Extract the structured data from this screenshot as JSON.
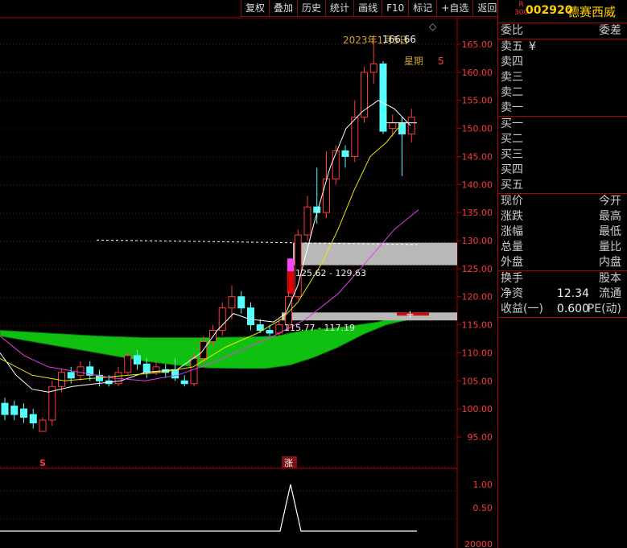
{
  "toolbar": {
    "buttons": [
      "复权",
      "叠加",
      "历史",
      "统计",
      "画线",
      "F10",
      "标记",
      "+自选",
      "返回"
    ]
  },
  "stock": {
    "badge_top": "R",
    "badge_bottom": "300",
    "code": "002920",
    "name": "德赛西威"
  },
  "panel": {
    "ratio_row": {
      "left": "委比",
      "right": "委差"
    },
    "sell_rows": [
      "卖五",
      "卖四",
      "卖三",
      "卖二",
      "卖一"
    ],
    "sell5_extra": "¥",
    "buy_rows": [
      "买一",
      "买二",
      "买三",
      "买四",
      "买五"
    ],
    "quote_rows": [
      {
        "left": "现价",
        "right": "今开"
      },
      {
        "left": "涨跌",
        "right": "最高"
      },
      {
        "left": "涨幅",
        "right": "最低"
      },
      {
        "left": "总量",
        "right": "量比"
      },
      {
        "left": "外盘",
        "right": "内盘"
      }
    ],
    "fund_rows": [
      {
        "left": "换手",
        "mid": "",
        "right": "股本"
      },
      {
        "left": "净资",
        "mid": "12.34",
        "right": "流通"
      },
      {
        "left": "收益(一)",
        "mid": "0.600",
        "right": "PE(动)"
      }
    ]
  },
  "chart": {
    "header_text": "2023年1月5日",
    "weekday_label": "星期",
    "weekday_value": "5",
    "high_marker": "166.66",
    "price_axis_ticks": [
      "165.00",
      "160.00",
      "155.00",
      "150.00",
      "145.00",
      "140.00",
      "135.00",
      "130.00",
      "125.00",
      "120.00",
      "115.00",
      "110.00",
      "105.00",
      "100.00",
      "95.00"
    ],
    "zone_upper_label": "125.62 - 129.63",
    "zone_lower_label": "115.77 - 117.19",
    "marker_s": "S",
    "marker_zhang": "涨",
    "indicator_ticks": [
      "1.00",
      "0.50"
    ],
    "indicator_bottom_tick": "20000",
    "colors": {
      "up": "#ff3a3a",
      "down": "#54ffff",
      "cloud": "#10c010",
      "ma_white": "#ffffff",
      "ma_yellow": "#e8e800",
      "ma_magenta": "#e040e0",
      "axis": "#b00000"
    }
  }
}
